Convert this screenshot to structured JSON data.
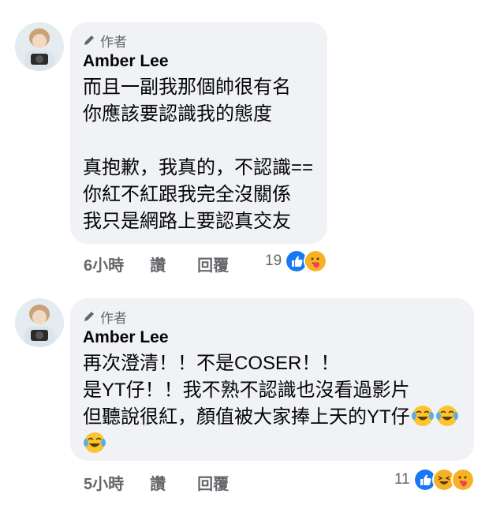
{
  "comments": [
    {
      "badge": "作者",
      "name": "Amber Lee",
      "lines": [
        "而且一副我那個帥很有名",
        "你應該要認識我的態度",
        "",
        "真抱歉，我真的，不認識==",
        "你紅不紅跟我完全沒關係",
        "我只是網路上要認真交友"
      ],
      "time": "6小時",
      "reply": "讚",
      "share": "回覆",
      "reaction_count": "19",
      "reactions": [
        "like-icon",
        "care-icon"
      ]
    },
    {
      "badge": "作者",
      "name": "Amber Lee",
      "lines": [
        "再次澄清！！不是COSER！！",
        "是YT仔！！我不熟不認識也沒看過影片",
        "但聽說很紅，顏值被大家捧上天的YT仔"
      ],
      "time": "5小時",
      "reply": "讚",
      "share": "回覆",
      "reaction_count": "11",
      "reactions": [
        "like-icon",
        "haha-icon",
        "care-icon"
      ]
    }
  ]
}
